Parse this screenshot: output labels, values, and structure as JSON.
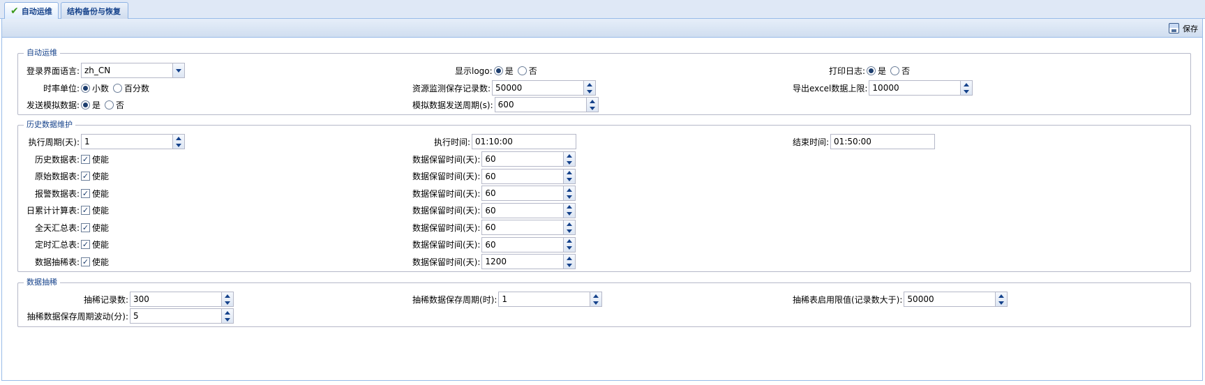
{
  "tabs": [
    {
      "label": "自动运维",
      "active": true
    },
    {
      "label": "结构备份与恢复",
      "active": false
    }
  ],
  "toolbar": {
    "save_label": "保存"
  },
  "auto_ops": {
    "legend": "自动运维",
    "login_language": {
      "label": "登录界面语言:",
      "value": "zh_CN"
    },
    "show_logo": {
      "label": "显示logo:",
      "yes": "是",
      "no": "否",
      "selected": "是"
    },
    "print_log": {
      "label": "打印日志:",
      "yes": "是",
      "no": "否",
      "selected": "是"
    },
    "rate_unit": {
      "label": "时率单位:",
      "opt1": "小数",
      "opt2": "百分数",
      "selected": "小数"
    },
    "monitor_records": {
      "label": "资源监测保存记录数:",
      "value": "50000"
    },
    "excel_limit": {
      "label": "导出excel数据上限:",
      "value": "10000"
    },
    "send_sim": {
      "label": "发送模拟数据:",
      "yes": "是",
      "no": "否",
      "selected": "是"
    },
    "sim_period": {
      "label": "模拟数据发送周期(s):",
      "value": "600"
    }
  },
  "history": {
    "legend": "历史数据维护",
    "period": {
      "label": "执行周期(天):",
      "value": "1"
    },
    "exec_time": {
      "label": "执行时间:",
      "value": "01:10:00"
    },
    "end_time": {
      "label": "结束时间:",
      "value": "01:50:00"
    },
    "enable_label": "使能",
    "retain_label": "数据保留时间(天):",
    "tables": [
      {
        "label": "历史数据表:",
        "enabled": true,
        "retain": "60"
      },
      {
        "label": "原始数据表:",
        "enabled": true,
        "retain": "60"
      },
      {
        "label": "报警数据表:",
        "enabled": true,
        "retain": "60"
      },
      {
        "label": "日累计计算表:",
        "enabled": true,
        "retain": "60"
      },
      {
        "label": "全天汇总表:",
        "enabled": true,
        "retain": "60"
      },
      {
        "label": "定时汇总表:",
        "enabled": true,
        "retain": "60"
      },
      {
        "label": "数据抽稀表:",
        "enabled": true,
        "retain": "1200"
      }
    ]
  },
  "thin": {
    "legend": "数据抽稀",
    "records": {
      "label": "抽稀记录数:",
      "value": "300"
    },
    "save_period": {
      "label": "抽稀数据保存周期(时):",
      "value": "1"
    },
    "threshold": {
      "label": "抽稀表启用限值(记录数大于):",
      "value": "50000"
    },
    "fluctuation": {
      "label": "抽稀数据保存周期波动(分):",
      "value": "5"
    }
  }
}
